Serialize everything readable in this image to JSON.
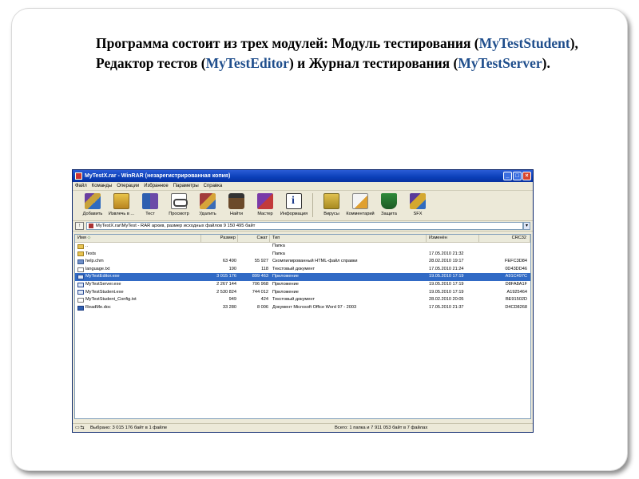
{
  "slide": {
    "intro_prefix": "Программа состоит из трех модулей: Модуль тестирования (",
    "mod1": "MyTestStudent",
    "intro_mid1": "), Редактор тестов (",
    "mod2": "MyTestEditor",
    "intro_mid2": ") и Журнал тестирования (",
    "mod3": "MyTestServer",
    "intro_end": ")."
  },
  "window": {
    "title": "MyTestX.rar - WinRAR (незарегистрированная копия)",
    "menu": [
      "Файл",
      "Команды",
      "Операции",
      "Избранное",
      "Параметры",
      "Справка"
    ],
    "toolbar": [
      {
        "label": "Добавить",
        "icon": "add-archive-icon"
      },
      {
        "label": "Извлечь в ...",
        "icon": "extract-icon"
      },
      {
        "label": "Тест",
        "icon": "test-icon"
      },
      {
        "label": "Просмотр",
        "icon": "view-icon"
      },
      {
        "label": "Удалить",
        "icon": "delete-icon"
      },
      {
        "label": "Найти",
        "icon": "find-icon"
      },
      {
        "label": "Мастер",
        "icon": "wizard-icon"
      },
      {
        "label": "Информация",
        "icon": "info-icon"
      },
      {
        "label": "Вирусы",
        "icon": "virus-scan-icon"
      },
      {
        "label": "Комментарий",
        "icon": "comment-icon"
      },
      {
        "label": "Защита",
        "icon": "protect-icon"
      },
      {
        "label": "SFX",
        "icon": "sfx-icon"
      }
    ],
    "path": "MyTestX.rar\\MyTest - RAR архив, размер исходных файлов 9 150 495 байт",
    "columns": {
      "name": "Имя",
      "size": "Размер",
      "packed": "Сжат",
      "type": "Тип",
      "modified": "Изменён",
      "crc": "CRC32"
    },
    "files": [
      {
        "name": "..",
        "size": "",
        "packed": "",
        "type": "Папка",
        "modified": "",
        "crc": "",
        "icon": "folder"
      },
      {
        "name": "Tests",
        "size": "",
        "packed": "",
        "type": "Папка",
        "modified": "17.05.2010 21:32",
        "crc": "",
        "icon": "folder"
      },
      {
        "name": "help.chm",
        "size": "63 490",
        "packed": "55 927",
        "type": "Скомпилированный HTML-файл справки",
        "modified": "28.02.2010 19:17",
        "crc": "FEFC3D84",
        "icon": "chm"
      },
      {
        "name": "language.txt",
        "size": "190",
        "packed": "118",
        "type": "Текстовый документ",
        "modified": "17.05.2010 21:24",
        "crc": "0D43DD46",
        "icon": "txt"
      },
      {
        "name": "MyTestEditor.exe",
        "size": "3 015 176",
        "packed": "899 463",
        "type": "Приложение",
        "modified": "19.05.2010 17:19",
        "crc": "A91C497C",
        "icon": "exe"
      },
      {
        "name": "MyTestServer.exe",
        "size": "2 267 144",
        "packed": "706 968",
        "type": "Приложение",
        "modified": "19.05.2010 17:19",
        "crc": "D8FA8A1F",
        "icon": "exe"
      },
      {
        "name": "MyTestStudent.exe",
        "size": "2 530 824",
        "packed": "744 012",
        "type": "Приложение",
        "modified": "19.05.2010 17:19",
        "crc": "A1925464",
        "icon": "exe"
      },
      {
        "name": "MyTestStudent_Config.txt",
        "size": "949",
        "packed": "424",
        "type": "Текстовый документ",
        "modified": "28.02.2010 20:05",
        "crc": "BE91502D",
        "icon": "txt"
      },
      {
        "name": "ReadMe.doc",
        "size": "33 280",
        "packed": "8 006",
        "type": "Документ Microsoft Office Word 97 - 2003",
        "modified": "17.05.2010 21:37",
        "crc": "D4CD8268",
        "icon": "doc"
      }
    ],
    "selected_index": 4,
    "status_left": "Выбрано: 3 015 176 байт в 1 файле",
    "status_right": "Всего: 1 папка и 7 911 053 байт в 7 файлах"
  }
}
